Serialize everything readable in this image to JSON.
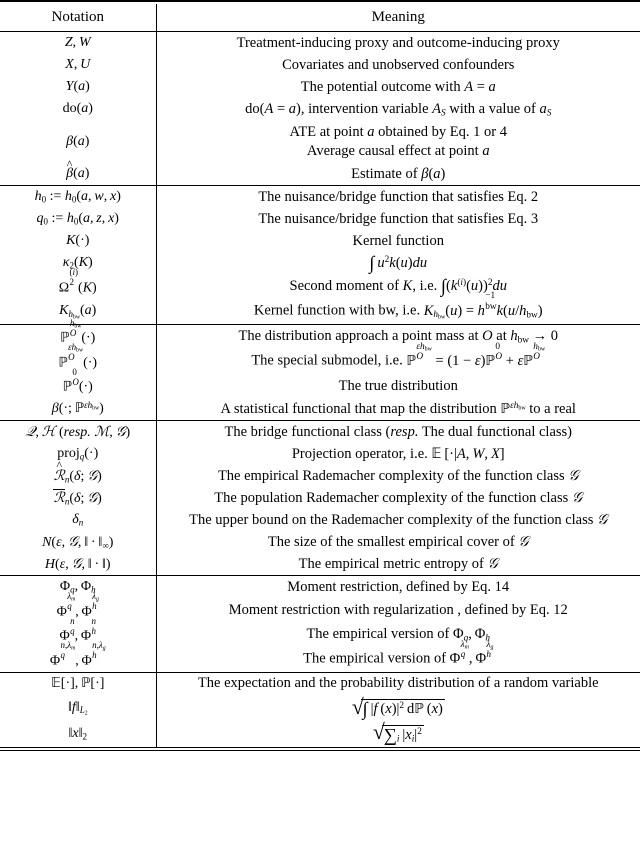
{
  "table": {
    "headers": {
      "notation": "Notation",
      "meaning": "Meaning"
    },
    "sections": [
      {
        "id": "causal-quantities",
        "rows": [
          {
            "notation_text": "Z, W",
            "meaning_text": "Treatment-inducing proxy and outcome-inducing proxy"
          },
          {
            "notation_text": "X, U",
            "meaning_text": "Covariates and unobserved confounders"
          },
          {
            "notation_text": "Y(a)",
            "meaning_text": "The potential outcome with A = a"
          },
          {
            "notation_text": "do(a)",
            "meaning_text": "do(A = a), intervention variable A_S with a value of a_S"
          },
          {
            "notation_text": "β(a)",
            "meaning_text": "ATE at point a obtained by Eq. 1 or 4",
            "meaning_text_line2": "Average causal effect at point a"
          },
          {
            "notation_text": "β̂(a)",
            "meaning_text": "Estimate of β(a)"
          }
        ]
      },
      {
        "id": "bridge-and-kernel",
        "rows": [
          {
            "notation_text": "h_0 := h_0(a, w, x)",
            "meaning_text": "The nuisance/bridge function that satisfies Eq. 2"
          },
          {
            "notation_text": "q_0 := h_0(a, z, x)",
            "meaning_text": "The nuisance/bridge function that satisfies Eq. 3"
          },
          {
            "notation_text": "K(·)",
            "meaning_text": "Kernel function"
          },
          {
            "notation_text": "κ_2(K)",
            "meaning_text": "∫ u²k(u)du"
          },
          {
            "notation_text": "Ω_2^(i)(K)",
            "meaning_text": "Second moment of K, i.e. ∫(k^(i)(u))²du"
          },
          {
            "notation_text": "K_{h_bw}(a)",
            "meaning_text": "Kernel function with bw, i.e. K_{h_bw}(u) = h_bw^{-1}k(u/h_bw)"
          }
        ]
      },
      {
        "id": "distributions",
        "rows": [
          {
            "notation_text": "ℙ_O^{h_bw}(·)",
            "meaning_text": "The distribution approach a point mass at O at h_bw → 0"
          },
          {
            "notation_text": "ℙ_O^{εh_bw}(·)",
            "meaning_text": "The special submodel, i.e. ℙ_O^{εh_bw} = (1 − ε)ℙ_O^0 + εℙ_O^{h_bw}"
          },
          {
            "notation_text": "ℙ_O^0(·)",
            "meaning_text": "The true distribution"
          },
          {
            "notation_text": "β(·; ℙ^{εh_bw})",
            "meaning_text": "A statistical functional that map the distribution ℙ^{εh_bw} to a real"
          }
        ]
      },
      {
        "id": "function-classes",
        "rows": [
          {
            "notation_text": "𝑄, 𝐻 (resp. 𝑀, 𝐺)",
            "meaning_text": "The bridge functional class (resp. The dual functional class)"
          },
          {
            "notation_text": "proj_q(·)",
            "meaning_text": "Projection operator, i.e. 𝔼[·|A, W, X]"
          },
          {
            "notation_text": "ℛ̂_n(δ; 𝐺)",
            "meaning_text": "The empirical Rademacher complexity of the function class 𝐺"
          },
          {
            "notation_text": "ℛ̄_n(δ; 𝐺)",
            "meaning_text": "The population Rademacher complexity of the function class 𝐺"
          },
          {
            "notation_text": "δ_n",
            "meaning_text": "The upper bound on the Rademacher complexity of the function class 𝐺"
          },
          {
            "notation_text": "N(ε, 𝐺, ‖ · ‖_∞)",
            "meaning_text": "The size of the smallest empirical cover of 𝐺"
          },
          {
            "notation_text": "H(ϵ, 𝐺, ‖ · ‖)",
            "meaning_text": "The empirical metric entropy of 𝐺"
          }
        ]
      },
      {
        "id": "moment-restrictions",
        "rows": [
          {
            "notation_text": "Φ_q, Φ_h",
            "meaning_text": "Moment restriction, defined by Eq. 14"
          },
          {
            "notation_text": "Φ_q^{λ_m}, Φ_h^{λ_g}",
            "meaning_text": "Moment restriction with regularization , defined by Eq. 12"
          },
          {
            "notation_text": "Φ_q^n, Φ_h^n",
            "meaning_text": "The empirical version of Φ_q, Φ_h"
          },
          {
            "notation_text": "Φ_q^{n,λ_m}, Φ_h^{n,λ_g}",
            "meaning_text": "The empirical version of Φ_q^{λ_m}, Φ_h^{λ_g}"
          }
        ]
      },
      {
        "id": "operators-and-norms",
        "rows": [
          {
            "notation_text": "𝔼[·], ℙ[·]",
            "meaning_text": "The expectation and the probability distribution of a random variable"
          },
          {
            "notation_text": "||f||_{L_2}",
            "meaning_text": "√(∫ |f(x)|² dℙ(x))"
          },
          {
            "notation_text": "||x||_2",
            "meaning_text": "√(∑_i |x_i|²)"
          }
        ]
      }
    ]
  }
}
